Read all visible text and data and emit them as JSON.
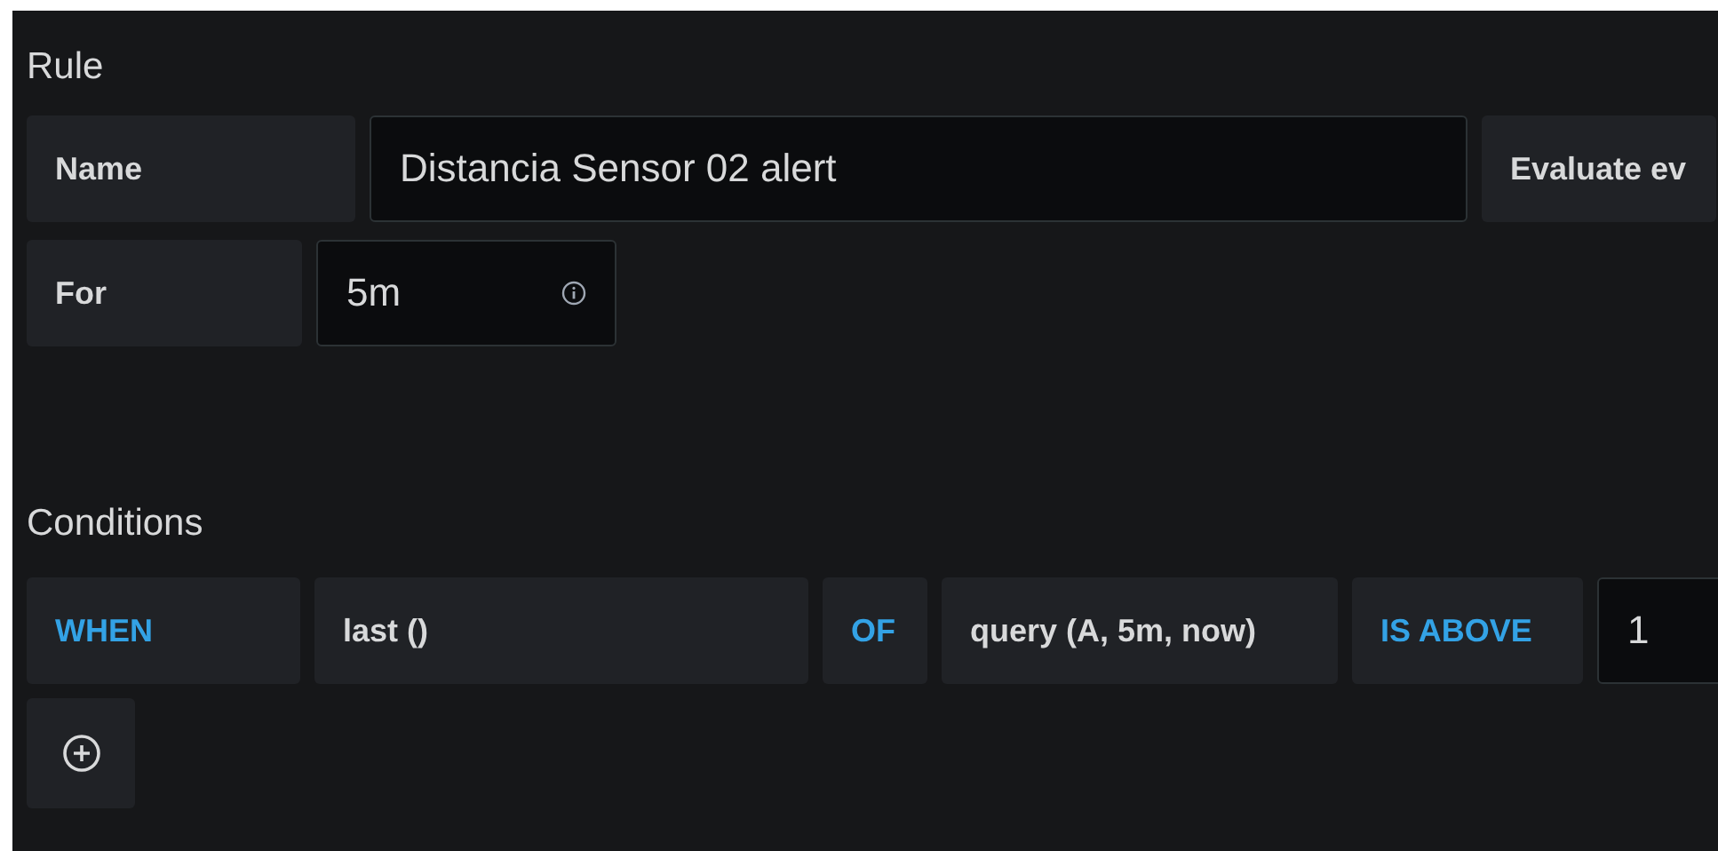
{
  "rule": {
    "title": "Rule",
    "fields": [
      {
        "label": "Name",
        "value": "Distancia Sensor 02 alert",
        "kind": "wide"
      },
      {
        "label": "Evaluate ev",
        "kind": "label_only"
      }
    ],
    "for": {
      "label": "For",
      "value": "5m"
    }
  },
  "conditions": {
    "title": "Conditions",
    "parts": [
      {
        "kind": "keyword",
        "text": "WHEN"
      },
      {
        "kind": "function",
        "text": "last ()"
      },
      {
        "kind": "keyword",
        "text": "OF"
      },
      {
        "kind": "function",
        "text": "query (A, 5m, now)"
      },
      {
        "kind": "keyword",
        "text": "IS ABOVE"
      },
      {
        "kind": "input",
        "text": "1"
      }
    ]
  }
}
